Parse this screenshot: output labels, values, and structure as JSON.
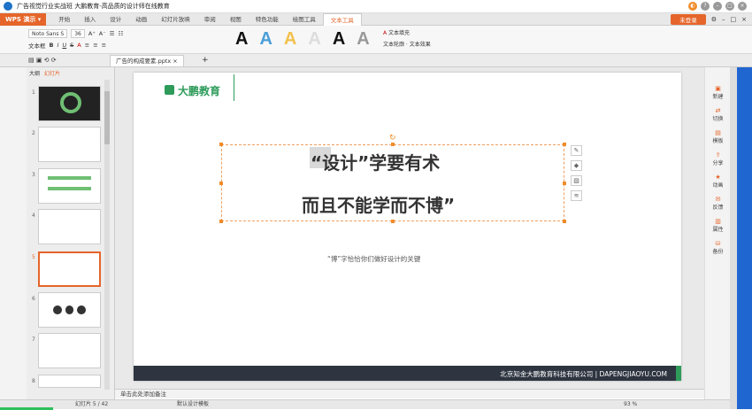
{
  "window": {
    "title": "广告视觉行业实战班 大鹏教育-高品质的设计师在线教育"
  },
  "menu": {
    "app_label": "WPS 演示",
    "items": [
      "开始",
      "插入",
      "设计",
      "动画",
      "幻灯片放映",
      "审阅",
      "视图",
      "特色功能",
      "绘图工具",
      "文本工具"
    ],
    "active": "文本工具",
    "login_label": "未登录"
  },
  "ribbon": {
    "font_name": "Noto Sans S",
    "font_size": "36",
    "textbox_label": "文本框",
    "style_glyph": "A",
    "text_fill": "文本填充",
    "text_outline": "文本轮廓",
    "text_effect": "文本效果"
  },
  "tabs": {
    "doc_name": "广告的构成要素.pptx",
    "add": "+"
  },
  "left_panel": {
    "tab1": "大纲",
    "tab2": "幻灯片",
    "slide_numbers": [
      "1",
      "2",
      "3",
      "4",
      "5",
      "6",
      "7",
      "8"
    ],
    "selected": "5"
  },
  "slide": {
    "logo_text": "大鹏教育",
    "line1": "“设计”学要有术",
    "line2": "而且不能学而不博”",
    "subtitle": "“博”字恰恰你们做好设计的关键",
    "footer": "北京知金大鹏教育科技有限公司  |  DAPENGJIAOYU.COM"
  },
  "right_panel": {
    "items": [
      "新建",
      "切换",
      "模板",
      "分享",
      "动画",
      "反馈",
      "属性",
      "备份"
    ]
  },
  "notes": {
    "placeholder": "单击此处添加备注"
  },
  "status": {
    "slide_info": "幻灯片 5 / 42",
    "theme": "默认设计模板",
    "zoom": "93 %"
  }
}
